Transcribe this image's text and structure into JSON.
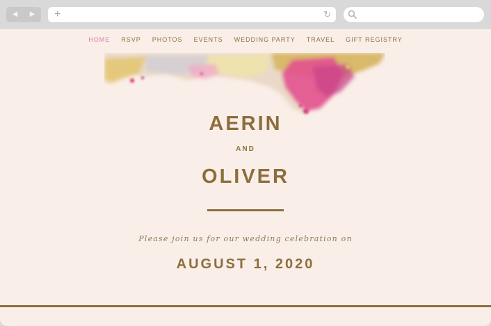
{
  "browser": {
    "back_icon": "◀",
    "forward_icon": "▶",
    "new_tab_icon": "+",
    "reload_icon": "↻"
  },
  "nav": {
    "items": [
      "HOME",
      "RSVP",
      "PHOTOS",
      "EVENTS",
      "WEDDING PARTY",
      "TRAVEL",
      "GIFT REGISTRY"
    ],
    "active": "HOME"
  },
  "hero": {
    "name1": "AERIN",
    "connector": "AND",
    "name2": "OLIVER",
    "invite": "Please join us for our wedding celebration on",
    "date": "AUGUST 1, 2020"
  },
  "colors": {
    "background": "#f9eee8",
    "gold": "#8c6e3c",
    "pink_accent": "#d67fa8"
  }
}
